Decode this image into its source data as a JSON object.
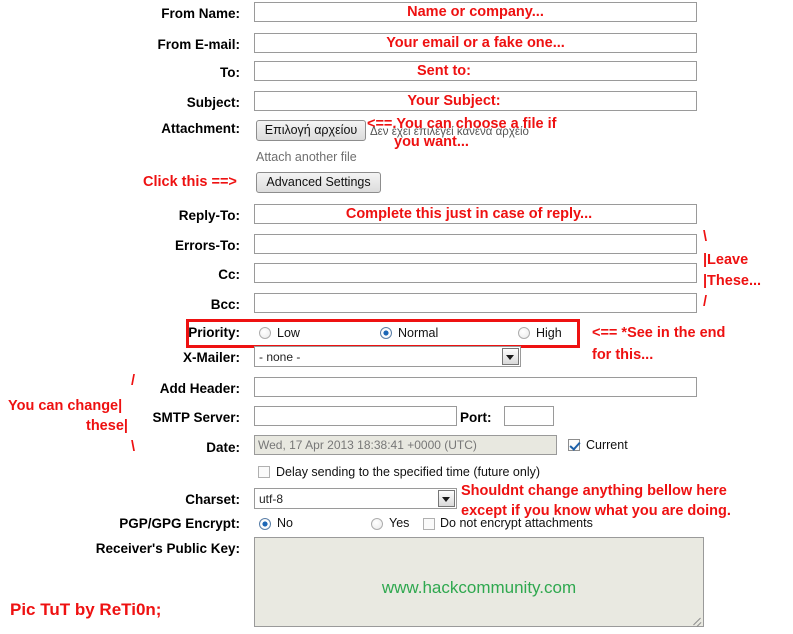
{
  "form": {
    "fields": [
      {
        "label": "From Name:",
        "annotation": "Name or company..."
      },
      {
        "label": "From E-mail:",
        "annotation": "Your email or a fake one..."
      },
      {
        "label": "To:",
        "annotation": "Sent to:"
      },
      {
        "label": "Subject:",
        "annotation": "Your Subject:"
      },
      {
        "label": "Attachment:",
        "annotation": ""
      },
      {
        "label": "Reply-To:",
        "annotation": "Complete this just in case of reply..."
      },
      {
        "label": "Errors-To:",
        "annotation": ""
      },
      {
        "label": "Cc:",
        "annotation": ""
      },
      {
        "label": "Bcc:",
        "annotation": ""
      },
      {
        "label": "Priority:",
        "annotation": ""
      },
      {
        "label": "X-Mailer:",
        "annotation": ""
      },
      {
        "label": "Add Header:",
        "annotation": ""
      },
      {
        "label": "SMTP Server:",
        "annotation": ""
      },
      {
        "label": "Date:",
        "annotation": ""
      },
      {
        "label": "Charset:",
        "annotation": ""
      },
      {
        "label": "PGP/GPG Encrypt:",
        "annotation": ""
      },
      {
        "label": "Receiver's Public Key:",
        "annotation": ""
      }
    ],
    "attachment": {
      "choose_button": "Επιλογή αρχείου",
      "no_file_text": "Δεν έχει επιλεγεί κανένα αρχείο",
      "attach_another": "Attach another file"
    },
    "advanced_settings_button": "Advanced Settings",
    "priority": {
      "options": [
        "Low",
        "Normal",
        "High"
      ],
      "selected": "Normal"
    },
    "x_mailer": {
      "value": "- none -"
    },
    "port": {
      "label": "Port:",
      "value": ""
    },
    "date": {
      "value": "Wed, 17 Apr 2013 18:38:41 +0000 (UTC)",
      "current_label": "Current",
      "current_checked": true,
      "delay_label": "Delay sending to the specified time (future only)",
      "delay_checked": false
    },
    "charset": {
      "value": "utf-8"
    },
    "pgp": {
      "options": [
        "No",
        "Yes"
      ],
      "selected": "No",
      "no_encrypt_attachments_label": "Do not encrypt attachments",
      "no_encrypt_checked": false
    },
    "public_key": {
      "value": ""
    }
  },
  "annotations": {
    "attachment_note_line1": "<==.You can choose a file if",
    "attachment_note_line2": "you want...",
    "click_this": "Click this ==>",
    "leave_these": "\\\n|Leave\n|These...\n/",
    "leave_these_l1": "\\",
    "leave_these_l2": "|Leave",
    "leave_these_l3": "|These...",
    "leave_these_l4": "/",
    "see_in_the_end_l1": "<== *See in the end",
    "see_in_the_end_l2": "for this...",
    "you_can_change_l1": "You can change|",
    "you_can_change_l2": "these|",
    "you_can_change_slash_top": "/",
    "you_can_change_slash_bottom": "\\",
    "shouldnt_change_l1": "Shouldnt change anything bellow here",
    "shouldnt_change_l2": "except if you know what you are doing."
  },
  "watermark": "www.hackcommunity.com",
  "signature": "Pic TuT by ReTi0n;",
  "colors": {
    "annotation_red": "#ee1111",
    "watermark_green": "#2fa84f",
    "input_border": "#9a9a9a",
    "readonly_bg": "#e8e8e0"
  }
}
